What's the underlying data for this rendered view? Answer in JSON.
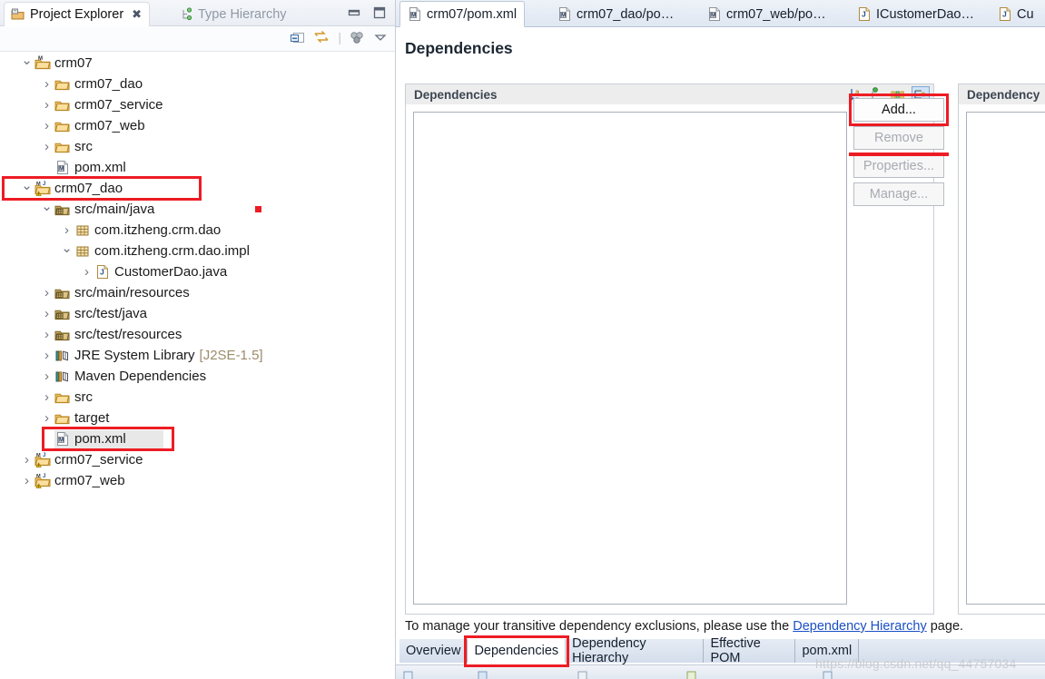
{
  "left_view": {
    "tabs": [
      {
        "label": "Project Explorer",
        "icon": "project-explorer-icon",
        "active": true,
        "close": "✖"
      },
      {
        "label": "Type Hierarchy",
        "icon": "type-hierarchy-icon",
        "active": false
      }
    ],
    "toolbar_icons": [
      "collapse-all-icon",
      "link-with-editor-icon",
      "view-menu-dots-icon",
      "view-menu-chevron-icon"
    ],
    "window_buttons": [
      "minimize-icon",
      "maximize-icon"
    ]
  },
  "tree": {
    "items": [
      {
        "label": "crm07",
        "indent": 0,
        "arrow": "down",
        "icon": "maven-project-icon"
      },
      {
        "label": "crm07_dao",
        "indent": 1,
        "arrow": "right",
        "icon": "folder-icon"
      },
      {
        "label": "crm07_service",
        "indent": 1,
        "arrow": "right",
        "icon": "folder-icon"
      },
      {
        "label": "crm07_web",
        "indent": 1,
        "arrow": "right",
        "icon": "folder-icon"
      },
      {
        "label": "src",
        "indent": 1,
        "arrow": "right",
        "icon": "folder-icon"
      },
      {
        "label": "pom.xml",
        "indent": 1,
        "arrow": "none",
        "icon": "maven-pom-icon"
      },
      {
        "label": "crm07_dao",
        "indent": 0,
        "arrow": "down",
        "icon": "maven-java-project-warning-icon",
        "highlight": true
      },
      {
        "label": "src/main/java",
        "indent": 1,
        "arrow": "down",
        "icon": "source-folder-icon",
        "marker": true
      },
      {
        "label": "com.itzheng.crm.dao",
        "indent": 2,
        "arrow": "right",
        "icon": "package-icon"
      },
      {
        "label": "com.itzheng.crm.dao.impl",
        "indent": 2,
        "arrow": "down",
        "icon": "package-icon"
      },
      {
        "label": "CustomerDao.java",
        "indent": 3,
        "arrow": "right",
        "icon": "java-file-icon"
      },
      {
        "label": "src/main/resources",
        "indent": 1,
        "arrow": "right",
        "icon": "source-folder-icon"
      },
      {
        "label": "src/test/java",
        "indent": 1,
        "arrow": "right",
        "icon": "source-folder-icon"
      },
      {
        "label": "src/test/resources",
        "indent": 1,
        "arrow": "right",
        "icon": "source-folder-icon"
      },
      {
        "label": "JRE System Library",
        "indent": 1,
        "arrow": "right",
        "icon": "library-icon",
        "sublabel": "[J2SE-1.5]"
      },
      {
        "label": "Maven Dependencies",
        "indent": 1,
        "arrow": "right",
        "icon": "library-icon"
      },
      {
        "label": "src",
        "indent": 1,
        "arrow": "right",
        "icon": "folder-icon"
      },
      {
        "label": "target",
        "indent": 1,
        "arrow": "right",
        "icon": "folder-icon"
      },
      {
        "label": "pom.xml",
        "indent": 1,
        "arrow": "none",
        "icon": "maven-pom-icon",
        "highlight": true,
        "selected": true
      },
      {
        "label": "crm07_service",
        "indent": 0,
        "arrow": "right",
        "icon": "maven-java-project-warning-icon"
      },
      {
        "label": "crm07_web",
        "indent": 0,
        "arrow": "right",
        "icon": "maven-java-project-warning-icon"
      }
    ]
  },
  "editor": {
    "tabs": [
      {
        "label": "crm07/pom.xml",
        "icon": "maven-pom-icon",
        "active": true
      },
      {
        "label": "crm07_dao/po…",
        "icon": "maven-pom-icon",
        "active": false
      },
      {
        "label": "crm07_web/po…",
        "icon": "maven-pom-icon",
        "active": false
      },
      {
        "label": "ICustomerDao…",
        "icon": "java-file-icon",
        "active": false
      },
      {
        "label": "Cu",
        "icon": "java-file-icon",
        "active": false
      }
    ],
    "title": "Dependencies",
    "sections": {
      "dependencies": {
        "header": "Dependencies",
        "toolbar_icons": [
          "sort-az-icon",
          "hierarchy-filter-icon",
          "columns-icon",
          "flat-view-icon"
        ],
        "buttons": [
          {
            "label": "Add...",
            "enabled": true,
            "highlight": true
          },
          {
            "label": "Remove",
            "enabled": false,
            "highlight": false
          },
          {
            "label": "Properties...",
            "enabled": false,
            "highlight": false
          },
          {
            "label": "Manage...",
            "enabled": false,
            "highlight": false
          }
        ]
      },
      "dependency_management": {
        "header": "Dependency"
      }
    },
    "note": {
      "before": "To manage your transitive dependency exclusions, please use the ",
      "link": "Dependency Hierarchy",
      "after": " page."
    },
    "page_tabs": [
      {
        "label": "Overview",
        "active": false,
        "highlight": false
      },
      {
        "label": "Dependencies",
        "active": true,
        "highlight": true
      },
      {
        "label": "Dependency Hierarchy",
        "active": false,
        "highlight": false
      },
      {
        "label": "Effective POM",
        "active": false,
        "highlight": false
      },
      {
        "label": "pom.xml",
        "active": false,
        "highlight": false
      }
    ]
  },
  "watermark": "https://blog.csdn.net/qq_44757034",
  "colors": {
    "highlight_red": "#ed1c24",
    "link_blue": "#1a4fc4",
    "folder_gold": "#e8a33d",
    "section_header_bg": "#ededed"
  }
}
